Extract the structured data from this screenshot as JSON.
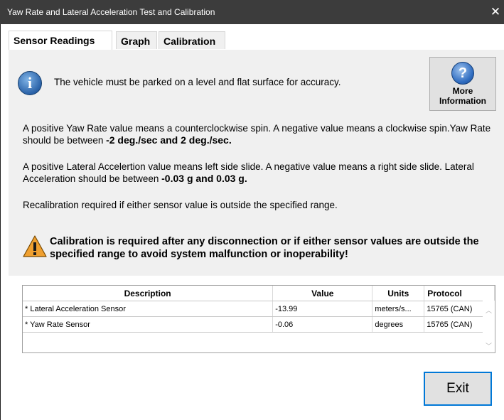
{
  "window": {
    "title": "Yaw Rate and Lateral Acceleration Test and Calibration",
    "close_glyph": "✕"
  },
  "tabs": [
    {
      "label": "Sensor Readings",
      "active": true
    },
    {
      "label": "Graph",
      "active": false
    },
    {
      "label": "Calibration",
      "active": false
    }
  ],
  "info": {
    "icon": "info-icon",
    "icon_glyph": "i",
    "message": "The vehicle must be parked on a level and flat surface for accuracy."
  },
  "more_info_button": {
    "icon": "help-icon",
    "icon_glyph": "?",
    "label_line1": "More",
    "label_line2": "Information"
  },
  "yaw_text": {
    "prefix": "A positive Yaw Rate value means a counterclockwise spin. A negative value means a clockwise spin.Yaw Rate should be between ",
    "range": "-2 deg./sec and 2 deg./sec."
  },
  "lat_text": {
    "prefix": "A positive Lateral Accelertion value means left side slide. A negative value means a right side slide. Lateral Acceleration should be between ",
    "range": "-0.03 g and 0.03 g."
  },
  "recal_text": "Recalibration required if either sensor value is outside the specified range.",
  "warning": {
    "icon": "warning-icon",
    "text": "Calibration is required after any disconnection or if either sensor values are outside the specified range to avoid system malfunction or inoperability!"
  },
  "table": {
    "headers": [
      "Description",
      "Value",
      "Units",
      "Protocol"
    ],
    "rows": [
      {
        "description": "* Lateral Acceleration Sensor",
        "value": "-13.99",
        "units": "meters/s...",
        "protocol": "15765 (CAN)"
      },
      {
        "description": "* Yaw Rate Sensor",
        "value": "-0.06",
        "units": "degrees",
        "protocol": "15765 (CAN)"
      }
    ],
    "scroll_up_glyph": "︿",
    "scroll_down_glyph": "﹀"
  },
  "exit_button": {
    "label": "Exit"
  },
  "colors": {
    "titlebar": "#3c3c3c",
    "panel": "#f0f0f0",
    "focus_border": "#0078d7",
    "info_blue": "#2a62a8",
    "warning_orange": "#f0a030"
  }
}
